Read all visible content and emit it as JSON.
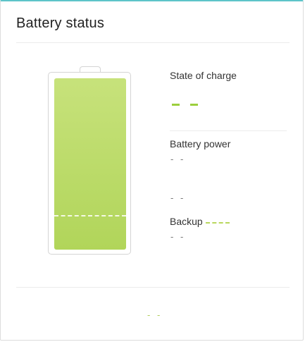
{
  "panel": {
    "title": "Battery status"
  },
  "battery": {
    "charge_level_fraction": 1.0,
    "backup_reserve_fraction": 0.2,
    "fill_color": "#b5d65f"
  },
  "state_of_charge": {
    "label": "State of charge",
    "value": "- -"
  },
  "battery_power": {
    "label": "Battery power",
    "value": "- -"
  },
  "middle_value": "- -",
  "backup": {
    "label": "Backup",
    "value": "- -",
    "legend_color": "#b8d75d"
  },
  "footer": {
    "value": "- -"
  },
  "colors": {
    "accent_top_border": "#5ec4c9",
    "charge_green": "#9ccf3d"
  }
}
